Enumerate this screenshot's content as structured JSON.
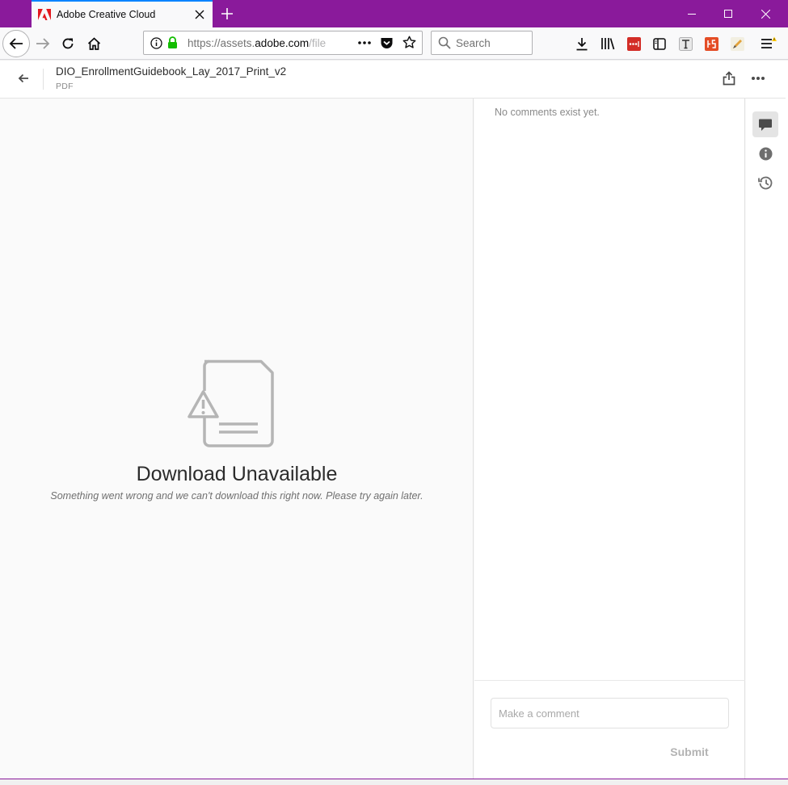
{
  "browser": {
    "tab_title": "Adobe Creative Cloud",
    "url_prefix": "https://assets.",
    "url_domain": "adobe.com",
    "url_path": "/file",
    "search_placeholder": "Search",
    "accent_color": "#8a1a9b"
  },
  "page": {
    "file_name": "DIO_EnrollmentGuidebook_Lay_2017_Print_v2",
    "file_type": "PDF"
  },
  "viewer": {
    "error_title": "Download Unavailable",
    "error_message": "Something went wrong and we can't download this right now. Please try again later."
  },
  "comments": {
    "empty_text": "No comments exist yet.",
    "input_placeholder": "Make a comment",
    "submit_label": "Submit"
  },
  "icons": {
    "tab": [
      "adobe-logo-icon",
      "close-icon",
      "plus-icon"
    ],
    "window": [
      "minimize-icon",
      "maximize-icon",
      "close-icon"
    ],
    "nav": [
      "back-arrow-icon",
      "forward-arrow-icon",
      "reload-icon",
      "home-icon",
      "info-icon",
      "lock-icon",
      "page-actions-icon",
      "pocket-icon",
      "bookmark-star-icon",
      "search-icon",
      "download-icon",
      "library-icon",
      "lastpass-icon",
      "sidebar-icon",
      "text-icon",
      "html5-icon",
      "edit-icon",
      "menu-icon"
    ],
    "page": [
      "back-arrow-icon",
      "share-icon",
      "more-icon",
      "file-warning-icon",
      "comment-icon",
      "info-icon",
      "history-icon"
    ]
  }
}
